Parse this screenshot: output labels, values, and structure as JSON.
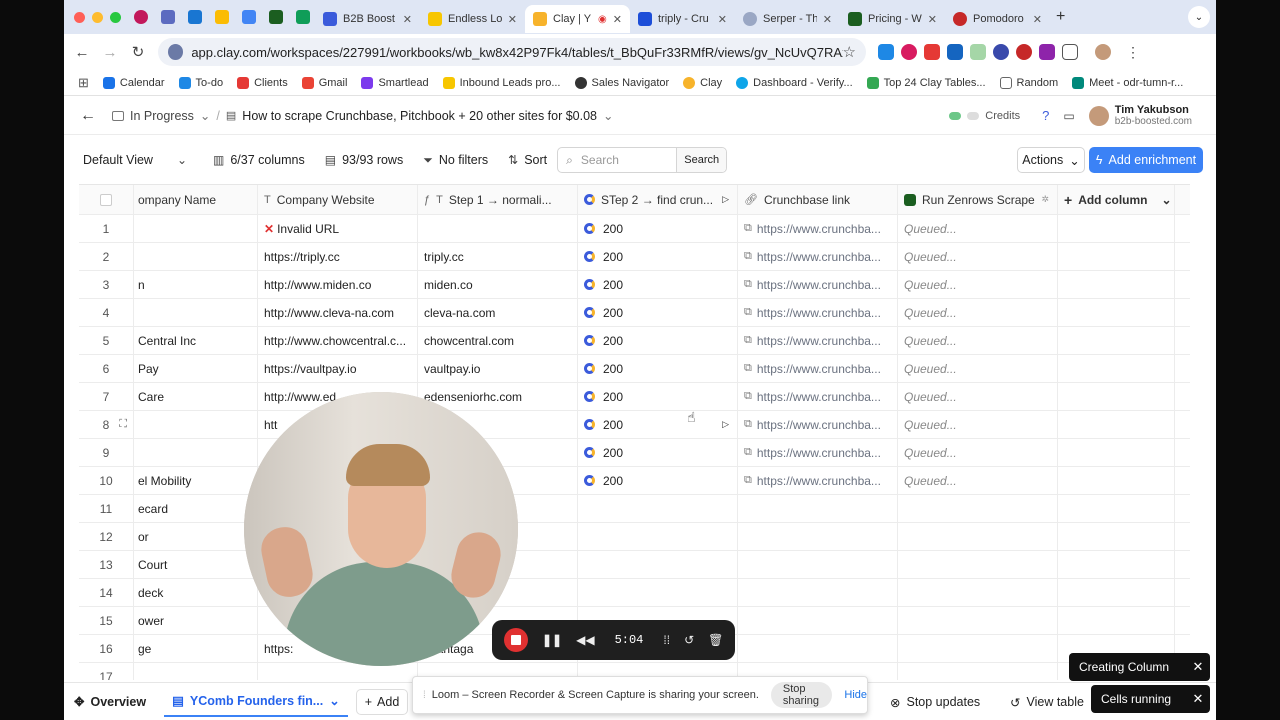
{
  "browser": {
    "tabs": [
      {
        "title": "B2B Boost",
        "color": "#3b5bdb"
      },
      {
        "title": "Endless Lo",
        "color": "#f7c600"
      },
      {
        "title": "Clay | Y",
        "color": "#f7b32b",
        "active": true
      },
      {
        "title": "triply - Cru",
        "color": "#1d4ed8"
      },
      {
        "title": "Serper - Th",
        "color": "#9aa7c4"
      },
      {
        "title": "Pricing - W",
        "color": "#1b5e20"
      },
      {
        "title": "Pomodoro",
        "color": "#c62828"
      }
    ],
    "url": "app.clay.com/workspaces/227991/workbooks/wb_kw8x42P97Fk4/tables/t_BbQuFr33RMfR/views/gv_NcUvQ7RAxgRc",
    "bookmarks": [
      {
        "label": "Calendar",
        "color": "#1a73e8"
      },
      {
        "label": "To-do",
        "color": "#1e88e5"
      },
      {
        "label": "Clients",
        "color": "#e53935"
      },
      {
        "label": "Gmail",
        "color": "#ea4335"
      },
      {
        "label": "Smartlead",
        "color": "#7c3aed"
      },
      {
        "label": "Inbound Leads pro...",
        "color": "#f7c600"
      },
      {
        "label": "Sales Navigator",
        "color": "#333333"
      },
      {
        "label": "Clay",
        "color": "#f7b32b"
      },
      {
        "label": "Dashboard - Verify...",
        "color": "#0ea5e9"
      },
      {
        "label": "Top 24 Clay Tables...",
        "color": "#34a853"
      },
      {
        "label": "Random",
        "color": "#666666"
      },
      {
        "label": "Meet - odr-tumn-r...",
        "color": "#00897b"
      }
    ]
  },
  "header": {
    "status": "In Progress",
    "title": "How to scrape Crunchbase, Pitchbook + 20 other sites for $0.08",
    "credits_label": "Credits",
    "user_name": "Tim Yakubson",
    "user_email": "b2b-boosted.com"
  },
  "toolbar": {
    "view": "Default View",
    "columns": "6/37 columns",
    "rows": "93/93 rows",
    "filters": "No filters",
    "sort": "Sort",
    "search_placeholder": "Search",
    "search_button": "Search",
    "actions": "Actions",
    "add_enrichment": "Add enrichment"
  },
  "table": {
    "columns": [
      "ompany Name",
      "Company Website",
      "Step 1 → normali...",
      "STep 2 → find crun...",
      "Crunchbase link",
      "Run Zenrows Scrape",
      "Add column"
    ],
    "rows": [
      {
        "n": "1",
        "name": "",
        "website": "Invalid URL",
        "invalid": true,
        "step1": "",
        "step2": "200",
        "cb": "https://www.crunchba...",
        "zen": "Queued..."
      },
      {
        "n": "2",
        "name": "",
        "website": "https://triply.cc",
        "step1": "triply.cc",
        "step2": "200",
        "cb": "https://www.crunchba...",
        "zen": "Queued..."
      },
      {
        "n": "3",
        "name": "n",
        "website": "http://www.miden.co",
        "step1": "miden.co",
        "step2": "200",
        "cb": "https://www.crunchba...",
        "zen": "Queued..."
      },
      {
        "n": "4",
        "name": "",
        "website": "http://www.cleva-na.com",
        "step1": "cleva-na.com",
        "step2": "200",
        "cb": "https://www.crunchba...",
        "zen": "Queued..."
      },
      {
        "n": "5",
        "name": "Central Inc",
        "website": "http://www.chowcentral.c...",
        "step1": "chowcentral.com",
        "step2": "200",
        "cb": "https://www.crunchba...",
        "zen": "Queued..."
      },
      {
        "n": "6",
        "name": "Pay",
        "website": "https://vaultpay.io",
        "step1": "vaultpay.io",
        "step2": "200",
        "cb": "https://www.crunchba...",
        "zen": "Queued..."
      },
      {
        "n": "7",
        "name": "Care",
        "website": "http://www.ed",
        "step1": "edenseniorhc.com",
        "step2": "200",
        "cb": "https://www.crunchba...",
        "zen": "Queued..."
      },
      {
        "n": "8",
        "name": "",
        "website": "htt",
        "step1": "o.co",
        "step2": "200",
        "cb": "https://www.crunchba...",
        "zen": "Queued..."
      },
      {
        "n": "9",
        "name": "",
        "website": "",
        "step1": "",
        "step2": "200",
        "cb": "https://www.crunchba...",
        "zen": "Queued..."
      },
      {
        "n": "10",
        "name": "el Mobility",
        "website": "",
        "step1": "y.com",
        "step2": "200",
        "cb": "https://www.crunchba...",
        "zen": "Queued..."
      },
      {
        "n": "11",
        "name": "ecard",
        "website": "",
        "step1": "",
        "step2": "",
        "cb": "",
        "zen": ""
      },
      {
        "n": "12",
        "name": "or",
        "website": "",
        "step1": "",
        "step2": "",
        "cb": "",
        "zen": ""
      },
      {
        "n": "13",
        "name": "Court",
        "website": "",
        "step1": "",
        "step2": "",
        "cb": "",
        "zen": ""
      },
      {
        "n": "14",
        "name": "deck",
        "website": "",
        "step1": "om",
        "step2": "",
        "cb": "",
        "zen": ""
      },
      {
        "n": "15",
        "name": "ower",
        "website": "",
        "step1": "er.nc",
        "step2": "",
        "cb": "",
        "zen": ""
      },
      {
        "n": "16",
        "name": "ge",
        "website": "https:",
        "step1": "atlantaga",
        "step2": "",
        "cb": "",
        "zen": ""
      },
      {
        "n": "17",
        "name": "",
        "website": "",
        "step1": "",
        "step2": "",
        "cb": "",
        "zen": ""
      }
    ]
  },
  "recorder": {
    "time": "5:04"
  },
  "bottom": {
    "overview": "Overview",
    "active_tab": "YComb Founders fin...",
    "add": "Add",
    "stop_updates": "Stop updates",
    "view_table": "View table"
  },
  "loom": {
    "message": "Loom – Screen Recorder & Screen Capture is sharing your screen.",
    "stop": "Stop sharing",
    "hide": "Hide"
  },
  "toasts": {
    "creating": "Creating Column",
    "running": "Cells running"
  }
}
